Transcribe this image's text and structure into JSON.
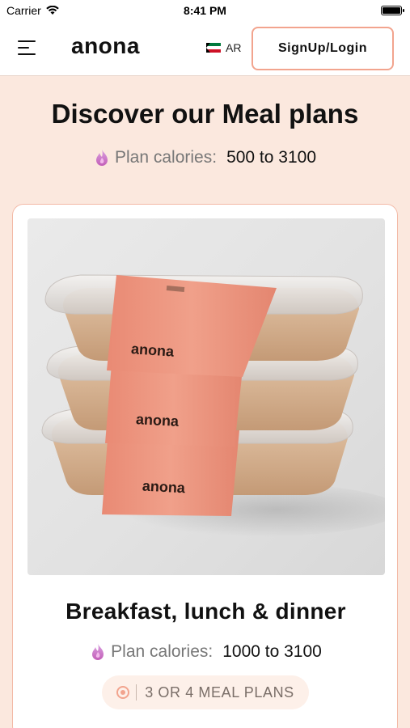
{
  "status_bar": {
    "carrier": "Carrier",
    "time": "8:41 PM"
  },
  "header": {
    "logo": "anona",
    "language": "AR",
    "signup_label": "SignUp/Login"
  },
  "hero": {
    "title": "Discover our Meal plans",
    "calories_label": "Plan calories:",
    "calories_value": "500 to 3100"
  },
  "plan_card": {
    "image_brand_text": [
      "anona",
      "anona",
      "anona"
    ],
    "title": "Breakfast, lunch & dinner",
    "calories_label": "Plan calories:",
    "calories_value": "1000 to 3100",
    "meal_plans_badge": "3 OR 4 MEAL PLANS"
  },
  "colors": {
    "page_background": "#fbe8de",
    "accent": "#f2a48e",
    "sleeve": "#ee9a84",
    "flame": "#c878c8"
  },
  "icons": [
    "menu-icon",
    "wifi-icon",
    "battery-icon",
    "kuwait-flag-icon",
    "flame-icon",
    "target-icon"
  ]
}
